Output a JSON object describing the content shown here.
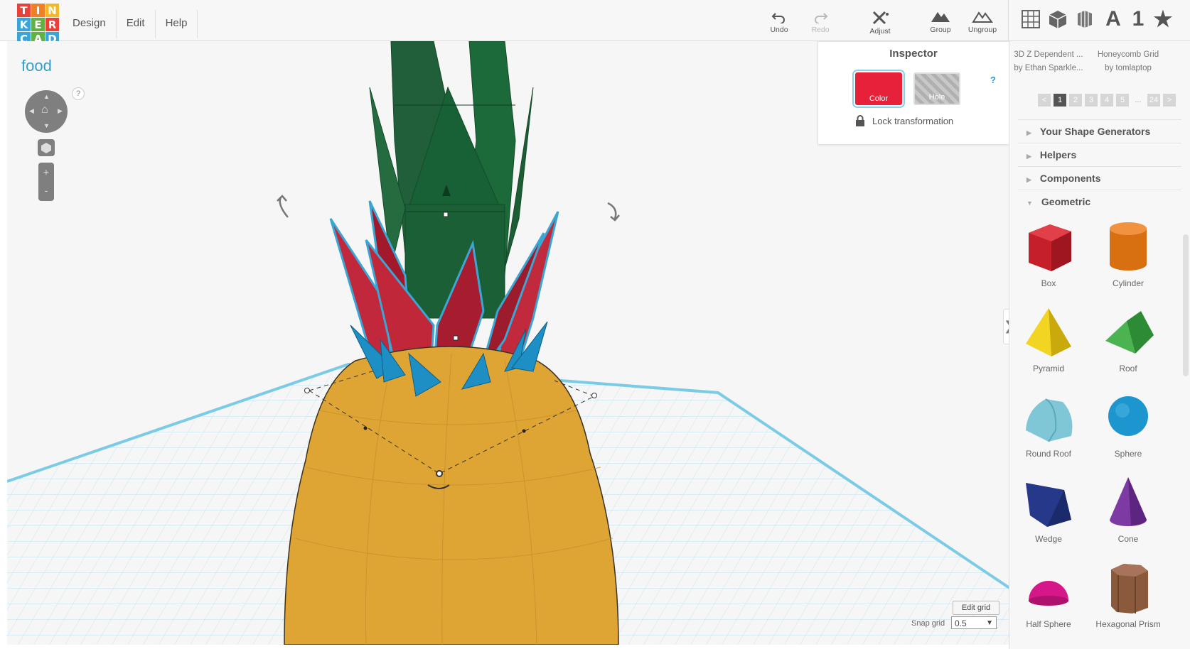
{
  "app": {
    "logo_letters": [
      "T",
      "I",
      "N",
      "K",
      "E",
      "R",
      "C",
      "A",
      "D"
    ],
    "logo_colors": [
      "#e8413a",
      "#f07f2a",
      "#f4b728",
      "#e8413a",
      "#61b144",
      "#e8413a",
      "#3aa3d8",
      "#61b144",
      "#3aa3d8"
    ]
  },
  "menu": {
    "items": [
      "Design",
      "Edit",
      "Help"
    ]
  },
  "toolbar": {
    "undo": "Undo",
    "redo": "Redo",
    "adjust": "Adjust",
    "group": "Group",
    "ungroup": "Ungroup"
  },
  "library_icons": [
    "grid-icon",
    "cube-icon",
    "cylinder-pattern-icon",
    "A",
    "1",
    "★"
  ],
  "document": {
    "name": "food"
  },
  "nav": {
    "help": "?",
    "zoom_in": "+",
    "zoom_out": "-"
  },
  "inspector": {
    "title": "Inspector",
    "color_label": "Color",
    "hole_label": "Hole",
    "help": "?",
    "lock_label": "Lock transformation",
    "color_value": "#e8213b"
  },
  "sidebar": {
    "featured": [
      {
        "title": "3D Z Dependent ...",
        "author": "by Ethan Sparkle..."
      },
      {
        "title": "Honeycomb Grid",
        "author": "by tomlaptop"
      }
    ],
    "pager": [
      "<",
      "1",
      "2",
      "3",
      "4",
      "5",
      "...",
      "24",
      ">"
    ],
    "pager_active": "1",
    "sections": [
      "Your Shape Generators",
      "Helpers",
      "Components",
      "Geometric"
    ],
    "shapes": [
      {
        "label": "Box"
      },
      {
        "label": "Cylinder"
      },
      {
        "label": "Pyramid"
      },
      {
        "label": "Roof"
      },
      {
        "label": "Round Roof"
      },
      {
        "label": "Sphere"
      },
      {
        "label": "Wedge"
      },
      {
        "label": "Cone"
      },
      {
        "label": "Half Sphere"
      },
      {
        "label": "Hexagonal Prism"
      }
    ]
  },
  "grid": {
    "edit_label": "Edit grid",
    "snap_label": "Snap grid",
    "snap_value": "0.5"
  },
  "colors": {
    "accent": "#33a0c9",
    "pineapple_body": "#dea434",
    "leaves": "#1f6b3c",
    "red_leaves": "#c0283a",
    "spikes": "#1d8fc4"
  }
}
